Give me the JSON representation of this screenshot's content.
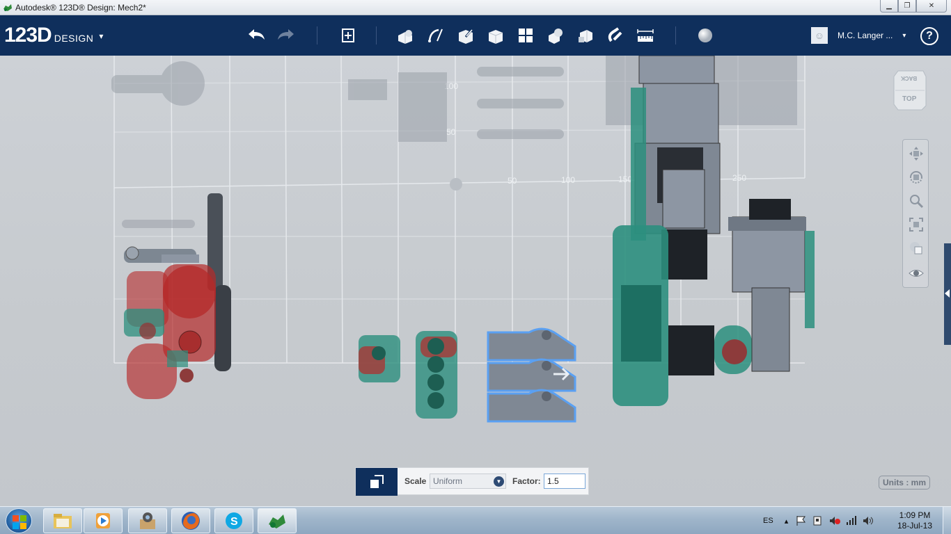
{
  "window": {
    "title": "Autodesk® 123D® Design: Mech2*",
    "minimize_glyph": "▁",
    "maximize_glyph": "❐",
    "close_glyph": "✕"
  },
  "toolbar": {
    "logo_big": "123D",
    "logo_small": "DESIGN",
    "logo_caret": "▾",
    "icons": [
      "undo-icon",
      "redo-icon",
      "transform-icon",
      "primitives-icon",
      "sketch-icon",
      "construct-icon",
      "modify-icon",
      "pattern-icon",
      "grouping-icon",
      "combine-icon",
      "snap-icon",
      "measure-icon",
      "material-icon"
    ],
    "user_name": "M.C. Langer ...",
    "user_caret": "▾",
    "help_label": "?"
  },
  "viewport": {
    "grid_labels": [
      "100",
      "50",
      "50",
      "100",
      "150",
      "250"
    ],
    "viewcube_top": "TOP",
    "viewcube_back": "BACK",
    "nav_tools": [
      "pan-icon",
      "orbit-icon",
      "zoom-icon",
      "fit-icon",
      "view-mode-icon",
      "visibility-icon"
    ],
    "units_label": "Units : mm",
    "selection_color": "#5aa0f2",
    "red_part_color": "#b52a2a",
    "teal_part_color": "#2c8f7e",
    "gray_part_color": "#8d96a3"
  },
  "scale_panel": {
    "scale_label": "Scale",
    "mode_value": "Uniform",
    "factor_label": "Factor:",
    "factor_value": "1.5"
  },
  "taskbar": {
    "apps": [
      "file-explorer-icon",
      "media-player-icon",
      "camera-app-icon",
      "firefox-icon",
      "skype-icon",
      "123d-design-icon"
    ],
    "language": "ES",
    "tray_caret": "▴",
    "time": "1:09 PM",
    "date": "18-Jul-13"
  }
}
